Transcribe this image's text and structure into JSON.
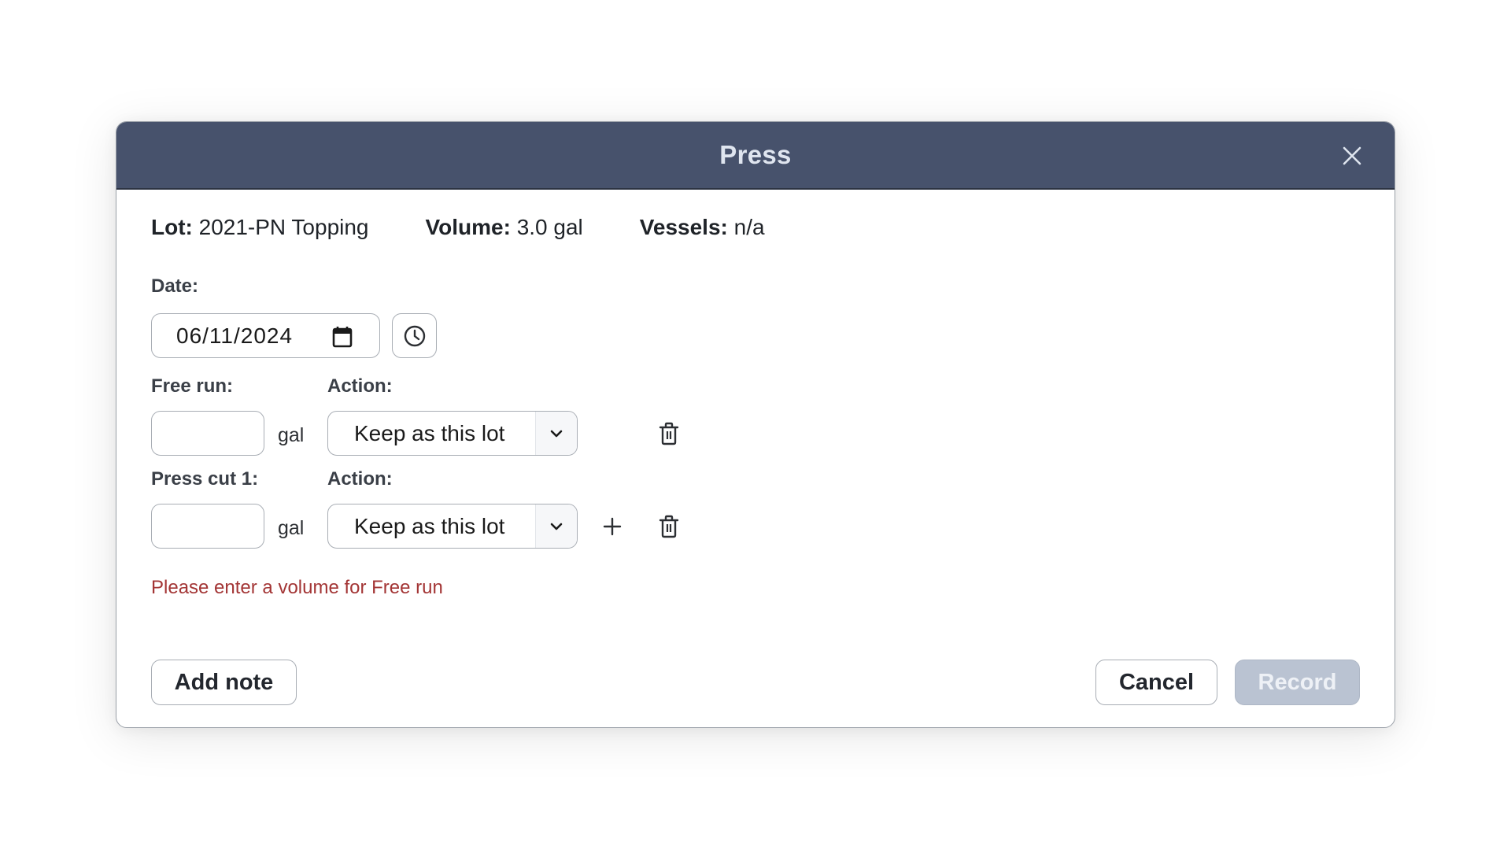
{
  "dialog": {
    "title": "Press",
    "close_icon": "close-icon"
  },
  "info": {
    "lot_label": "Lot:",
    "lot_value": "2021-PN Topping",
    "volume_label": "Volume:",
    "volume_value": "3.0 gal",
    "vessels_label": "Vessels:",
    "vessels_value": "n/a"
  },
  "date": {
    "label": "Date:",
    "value": "06/11/2024",
    "calendar_icon": "calendar-icon",
    "clock_icon": "clock-icon"
  },
  "rows": [
    {
      "label": "Free run:",
      "volume_value": "",
      "unit": "gal",
      "action_label": "Action:",
      "action_value": "Keep as this lot",
      "has_add": false
    },
    {
      "label": "Press cut 1:",
      "volume_value": "",
      "unit": "gal",
      "action_label": "Action:",
      "action_value": "Keep as this lot",
      "has_add": true
    }
  ],
  "error_message": "Please enter a volume for Free run",
  "footer": {
    "add_note_label": "Add note",
    "cancel_label": "Cancel",
    "record_label": "Record"
  },
  "colors": {
    "header_bg": "#47526c",
    "error": "#a33535",
    "disabled_button": "#bac3d2"
  }
}
